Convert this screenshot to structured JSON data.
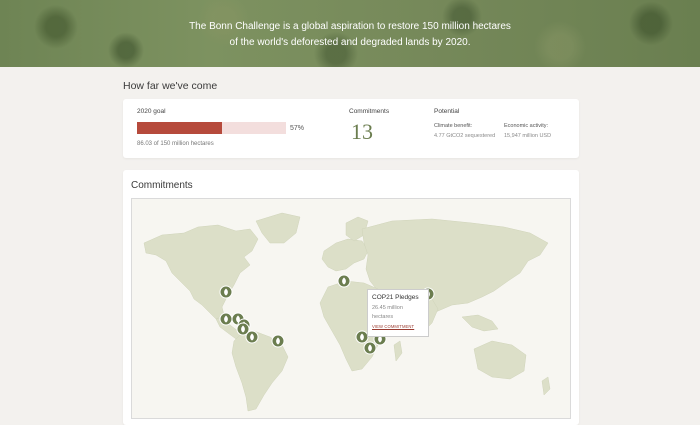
{
  "hero": {
    "line1": "The Bonn Challenge is a global aspiration to restore 150 million hectares",
    "line2": "of the world's deforested and degraded lands by 2020."
  },
  "progress": {
    "section_title": "How far we've come",
    "goal_label": "2020 goal",
    "percent": 57,
    "percent_text": "57%",
    "sub_text": "86.03 of 150 million hectares",
    "bar_fill_color": "#b64a3c",
    "bar_track_color": "#f3dedd"
  },
  "commitments_stat": {
    "label": "Commitments",
    "value": "13"
  },
  "potential": {
    "label": "Potential",
    "climate_label": "Climate benefit:",
    "climate_value": "4.77 GtCO2 sequestered",
    "economic_label": "Economic activity:",
    "economic_value": "15,947 million USD"
  },
  "map": {
    "title": "Commitments",
    "marker_icon": "leaf-icon",
    "marker_color": "#6b7d4f",
    "land_color": "#dcdfc8",
    "tooltip": {
      "title": "COP21 Pledges",
      "value": "26.45 million hectares",
      "link": "VIEW COMMITMENT"
    }
  }
}
